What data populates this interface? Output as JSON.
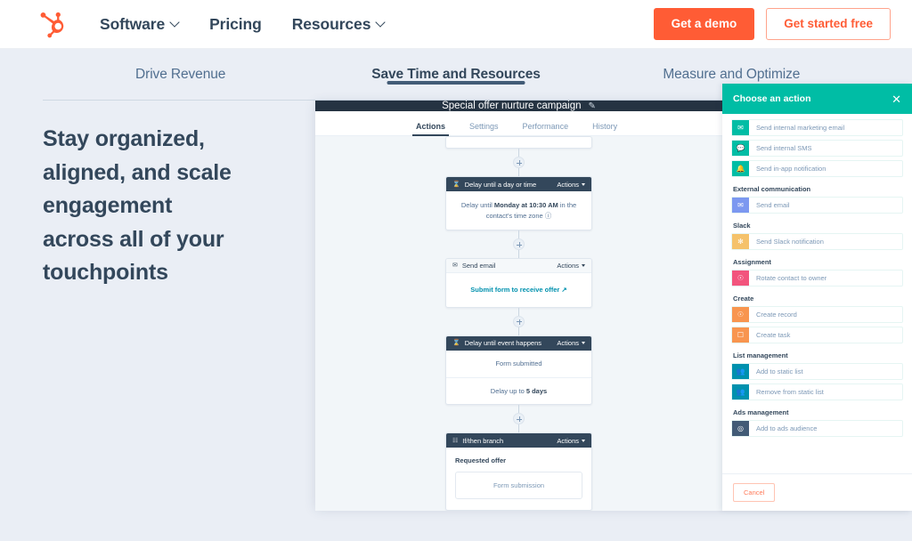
{
  "topnav": {
    "logo_name": "hubspot-logo",
    "links": [
      {
        "label": "Software",
        "has_chevron": true
      },
      {
        "label": "Pricing",
        "has_chevron": false
      },
      {
        "label": "Resources",
        "has_chevron": true
      }
    ],
    "demo_button": "Get a demo",
    "free_button": "Get started free",
    "accent_color": "#ff5c35"
  },
  "tabs": [
    {
      "label": "Drive Revenue",
      "active": false
    },
    {
      "label": "Save Time and Resources",
      "active": true
    },
    {
      "label": "Measure and Optimize",
      "active": false
    }
  ],
  "hero": {
    "headline": "Stay organized, aligned, and scale engagement across all of your touchpoints"
  },
  "app": {
    "title": "Special offer nurture campaign",
    "edit_icon": "pencil-icon",
    "tabs": [
      {
        "label": "Actions",
        "active": true
      },
      {
        "label": "Settings",
        "active": false
      },
      {
        "label": "Performance",
        "active": false
      },
      {
        "label": "History",
        "active": false
      }
    ],
    "actions_menu_label": "Actions",
    "cards": [
      {
        "id": "delay-day-time",
        "header": "Delay until a day or time",
        "header_style": "dark",
        "icon": "hourglass-icon",
        "body_prefix": "Delay until ",
        "body_bold": "Monday at 10:30 AM",
        "body_suffix": " in the contact's time zone ⓘ"
      },
      {
        "id": "send-email",
        "header": "Send email",
        "header_style": "light",
        "icon": "envelope-icon",
        "link_text": "Submit form to receive offer",
        "link_icon": "external-link-icon"
      },
      {
        "id": "delay-event",
        "header": "Delay until event happens",
        "header_style": "dark",
        "icon": "hourglass-icon",
        "row_one": "Form submitted",
        "row_two_prefix": "Delay up to ",
        "row_two_bold": "5 days"
      },
      {
        "id": "if-then-branch",
        "header": "If/then branch",
        "header_style": "dark",
        "icon": "branch-icon",
        "branch_label": "Requested offer",
        "branch_box": "Form submission"
      }
    ]
  },
  "panel": {
    "title": "Choose an action",
    "close_icon": "close-icon",
    "header_color": "#00bda5",
    "cancel_label": "Cancel",
    "groups": [
      {
        "label": "",
        "items": [
          {
            "label": "Send internal marketing email",
            "icon": "envelope-icon",
            "color": "#00bda5"
          },
          {
            "label": "Send internal SMS",
            "icon": "chat-icon",
            "color": "#00bda5"
          },
          {
            "label": "Send in-app notification",
            "icon": "bell-icon",
            "color": "#00bda5"
          }
        ]
      },
      {
        "label": "External communication",
        "items": [
          {
            "label": "Send email",
            "icon": "envelope-icon",
            "color": "#7c98f0"
          }
        ]
      },
      {
        "label": "Slack",
        "items": [
          {
            "label": "Send Slack notification",
            "icon": "slack-icon",
            "color": "#f5c26b"
          }
        ]
      },
      {
        "label": "Assignment",
        "items": [
          {
            "label": "Rotate contact to owner",
            "icon": "user-rotate-icon",
            "color": "#f2547d"
          }
        ]
      },
      {
        "label": "Create",
        "items": [
          {
            "label": "Create record",
            "icon": "record-icon",
            "color": "#f8954f"
          },
          {
            "label": "Create task",
            "icon": "task-icon",
            "color": "#f8954f"
          }
        ]
      },
      {
        "label": "List management",
        "items": [
          {
            "label": "Add to static list",
            "icon": "people-icon",
            "color": "#0091ae"
          },
          {
            "label": "Remove from static list",
            "icon": "people-icon",
            "color": "#0091ae"
          }
        ]
      },
      {
        "label": "Ads management",
        "items": [
          {
            "label": "Add to ads audience",
            "icon": "target-icon",
            "color": "#425b76"
          }
        ]
      }
    ]
  }
}
